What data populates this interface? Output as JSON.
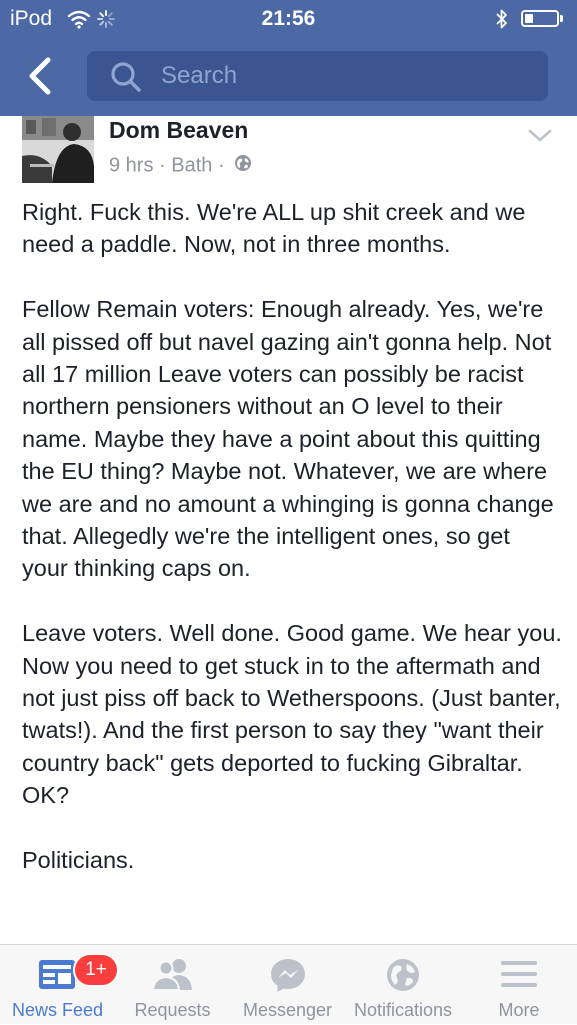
{
  "status_bar": {
    "device": "iPod",
    "time": "21:56",
    "battery_level": 0.25
  },
  "nav": {
    "search_placeholder": "Search"
  },
  "post": {
    "author": "Dom Beaven",
    "time": "9 hrs",
    "location": "Bath",
    "separator": "·",
    "paragraphs": [
      "Right. Fuck this. We're ALL up shit creek and we need a paddle. Now, not in three months.",
      "Fellow Remain voters: Enough already. Yes, we're all pissed off but navel gazing ain't gonna help. Not all 17 million Leave voters can possibly be racist northern pensioners without an O level to their name. Maybe they have a point about this quitting the EU thing? Maybe not. Whatever, we are where we are and no amount a whinging is gonna change that. Allegedly we're the intelligent ones, so get your thinking caps on.",
      "Leave voters. Well done. Good game. We hear you. Now you need to get stuck in to the aftermath and not just piss off back to Wetherspoons. (Just banter, twats!). And the first person to say they \"want their country back\" gets deported to fucking Gibraltar. OK?",
      "Politicians."
    ]
  },
  "tabs": [
    {
      "label": "News Feed",
      "icon": "news-feed-icon",
      "badge": "1+",
      "active": true
    },
    {
      "label": "Requests",
      "icon": "friend-requests-icon"
    },
    {
      "label": "Messenger",
      "icon": "messenger-icon"
    },
    {
      "label": "Notifications",
      "icon": "globe-icon"
    },
    {
      "label": "More",
      "icon": "hamburger-menu-icon"
    }
  ],
  "colors": {
    "header_blue": "#4c69a6",
    "search_field": "#3a5590",
    "active_tab": "#4b7bd1",
    "badge_red": "#fa3e3e"
  }
}
